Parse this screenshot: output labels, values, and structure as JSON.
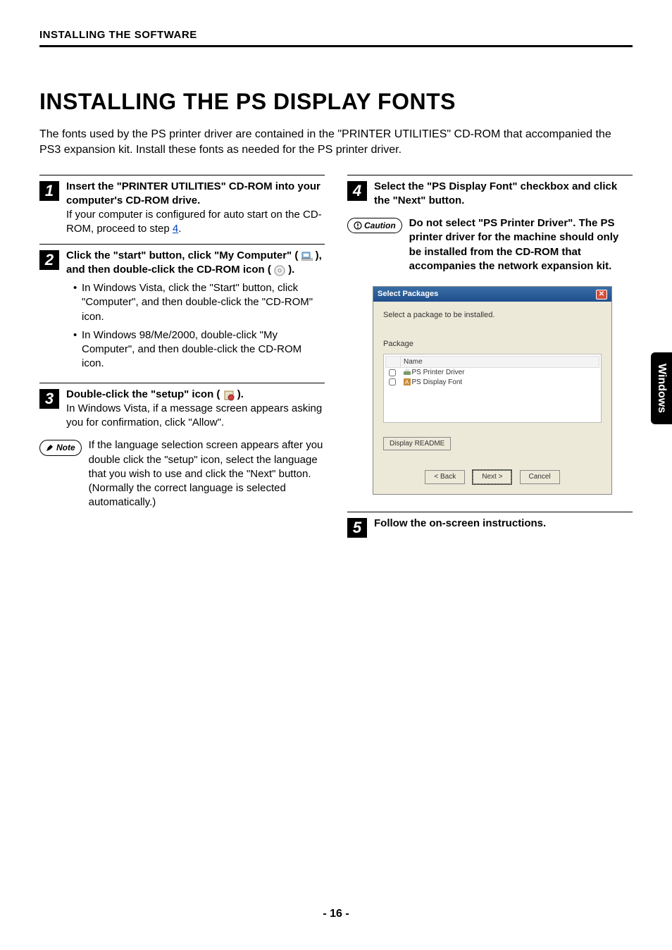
{
  "header": "INSTALLING THE SOFTWARE",
  "title": "INSTALLING THE PS DISPLAY FONTS",
  "intro": "The fonts used by the PS printer driver are contained in the \"PRINTER UTILITIES\" CD-ROM that accompanied the PS3 expansion kit. Install these fonts as needed for the PS printer driver.",
  "sidetab": "Windows",
  "pagenum": "- 16 -",
  "steps": {
    "s1": {
      "num": "1",
      "bold": "Insert the \"PRINTER UTILITIES\" CD-ROM into your computer's CD-ROM drive.",
      "plain_a": "If your computer is configured for auto start on the CD-ROM, proceed to step ",
      "link": "4",
      "plain_b": "."
    },
    "s2": {
      "num": "2",
      "bold_a": "Click the \"start\" button, click \"My Computer\" (",
      "bold_b": "), and then double-click the CD-ROM icon (",
      "bold_c": ").",
      "bul1": "In Windows Vista, click the \"Start\" button, click \"Computer\", and then double-click the \"CD-ROM\" icon.",
      "bul2": "In Windows 98/Me/2000, double-click \"My Computer\", and then double-click the CD-ROM icon."
    },
    "s3": {
      "num": "3",
      "bold_a": "Double-click the \"setup\" icon (",
      "bold_b": ").",
      "plain": "In Windows Vista, if a message screen appears asking you for confirmation, click \"Allow\"."
    },
    "note": {
      "label": "Note",
      "text": "If the language selection screen appears after you double click the \"setup\" icon, select the language that you wish to use and click the \"Next\" button. (Normally the correct language is selected automatically.)"
    },
    "s4": {
      "num": "4",
      "bold": "Select the \"PS Display Font\" checkbox and click the \"Next\" button."
    },
    "caution": {
      "label": "Caution",
      "text": "Do not select \"PS Printer Driver\". The PS printer driver for the machine should only be installed from the CD-ROM that accompanies the network expansion kit."
    },
    "s5": {
      "num": "5",
      "bold": "Follow the on-screen instructions."
    }
  },
  "shot": {
    "title": "Select Packages",
    "prompt": "Select a package to be installed.",
    "grouplabel": "Package",
    "colhead": "Name",
    "item1": "PS Printer Driver",
    "item2": "PS Display Font",
    "readme": "Display README",
    "back": "< Back",
    "next": "Next >",
    "cancel": "Cancel"
  }
}
